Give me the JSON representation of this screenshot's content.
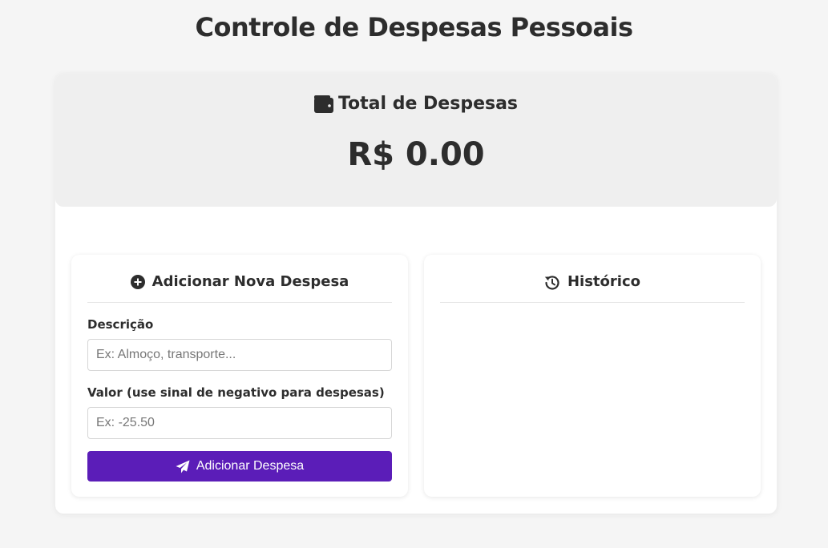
{
  "page": {
    "title": "Controle de Despesas Pessoais"
  },
  "summary": {
    "heading": "Total de Despesas",
    "heading_icon": "wallet-icon",
    "total": "R$ 0.00"
  },
  "form": {
    "heading": "Adicionar Nova Despesa",
    "heading_icon": "plus-circle-icon",
    "description_label": "Descrição",
    "description_placeholder": "Ex: Almoço, transporte...",
    "description_value": "",
    "amount_label": "Valor (use sinal de negativo para despesas)",
    "amount_placeholder": "Ex: -25.50",
    "amount_value": "",
    "submit_label": "Adicionar Despesa",
    "submit_icon": "paper-plane-icon"
  },
  "history": {
    "heading": "Histórico",
    "heading_icon": "history-icon",
    "items": []
  },
  "colors": {
    "accent": "#5b1db8",
    "page_background": "#f5f5f5",
    "summary_background": "#efefef",
    "text": "#2d2d2d"
  }
}
